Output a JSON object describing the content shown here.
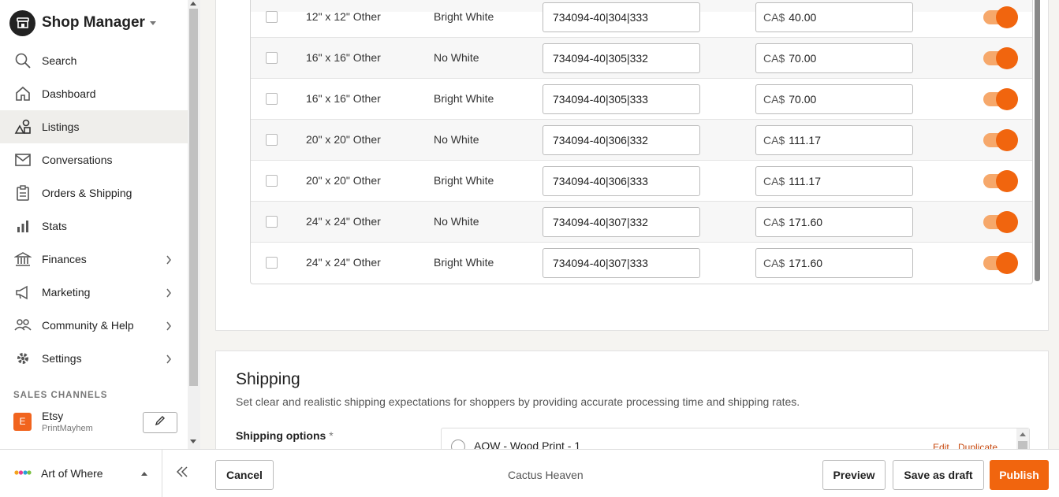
{
  "sidebar": {
    "title": "Shop Manager",
    "items": [
      {
        "label": "Search",
        "icon": "search-icon",
        "active": false,
        "chevron": false
      },
      {
        "label": "Dashboard",
        "icon": "home-icon",
        "active": false,
        "chevron": false
      },
      {
        "label": "Listings",
        "icon": "shapes-icon",
        "active": true,
        "chevron": false
      },
      {
        "label": "Conversations",
        "icon": "envelope-icon",
        "active": false,
        "chevron": false
      },
      {
        "label": "Orders & Shipping",
        "icon": "clipboard-icon",
        "active": false,
        "chevron": false
      },
      {
        "label": "Stats",
        "icon": "bar-chart-icon",
        "active": false,
        "chevron": false
      },
      {
        "label": "Finances",
        "icon": "bank-icon",
        "active": false,
        "chevron": true
      },
      {
        "label": "Marketing",
        "icon": "megaphone-icon",
        "active": false,
        "chevron": true
      },
      {
        "label": "Community & Help",
        "icon": "people-icon",
        "active": false,
        "chevron": true
      },
      {
        "label": "Settings",
        "icon": "gear-icon",
        "active": false,
        "chevron": true
      }
    ],
    "sales_channels_title": "SALES CHANNELS",
    "channel": {
      "badge": "E",
      "name": "Etsy",
      "shop": "PrintMayhem"
    }
  },
  "bottom_left": {
    "shop_label": "Art of Where"
  },
  "variants": [
    {
      "size": "12\" x 12\" Other",
      "color": "Bright White",
      "sku": "734094-40|304|333",
      "currency": "CA$",
      "price": "40.00",
      "enabled": true
    },
    {
      "size": "16\" x 16\" Other",
      "color": "No White",
      "sku": "734094-40|305|332",
      "currency": "CA$",
      "price": "70.00",
      "enabled": true
    },
    {
      "size": "16\" x 16\" Other",
      "color": "Bright White",
      "sku": "734094-40|305|333",
      "currency": "CA$",
      "price": "70.00",
      "enabled": true
    },
    {
      "size": "20\" x 20\" Other",
      "color": "No White",
      "sku": "734094-40|306|332",
      "currency": "CA$",
      "price": "111.17",
      "enabled": true
    },
    {
      "size": "20\" x 20\" Other",
      "color": "Bright White",
      "sku": "734094-40|306|333",
      "currency": "CA$",
      "price": "111.17",
      "enabled": true
    },
    {
      "size": "24\" x 24\" Other",
      "color": "No White",
      "sku": "734094-40|307|332",
      "currency": "CA$",
      "price": "171.60",
      "enabled": true
    },
    {
      "size": "24\" x 24\" Other",
      "color": "Bright White",
      "sku": "734094-40|307|333",
      "currency": "CA$",
      "price": "171.60",
      "enabled": true
    }
  ],
  "shipping": {
    "title": "Shipping",
    "description": "Set clear and realistic shipping expectations for shoppers by providing accurate processing time and shipping rates.",
    "options_label": "Shipping options",
    "required_mark": "*",
    "profile_name": "AOW - Wood Print - 1",
    "edit_label": "Edit",
    "duplicate_label": "Duplicate"
  },
  "actions": {
    "cancel": "Cancel",
    "listing_name": "Cactus Heaven",
    "preview": "Preview",
    "save_draft": "Save as draft",
    "publish": "Publish"
  },
  "colors": {
    "accent": "#f1650e",
    "toggle_track": "#f6a86b",
    "link": "#c84c13",
    "etsy": "#f1641e"
  }
}
